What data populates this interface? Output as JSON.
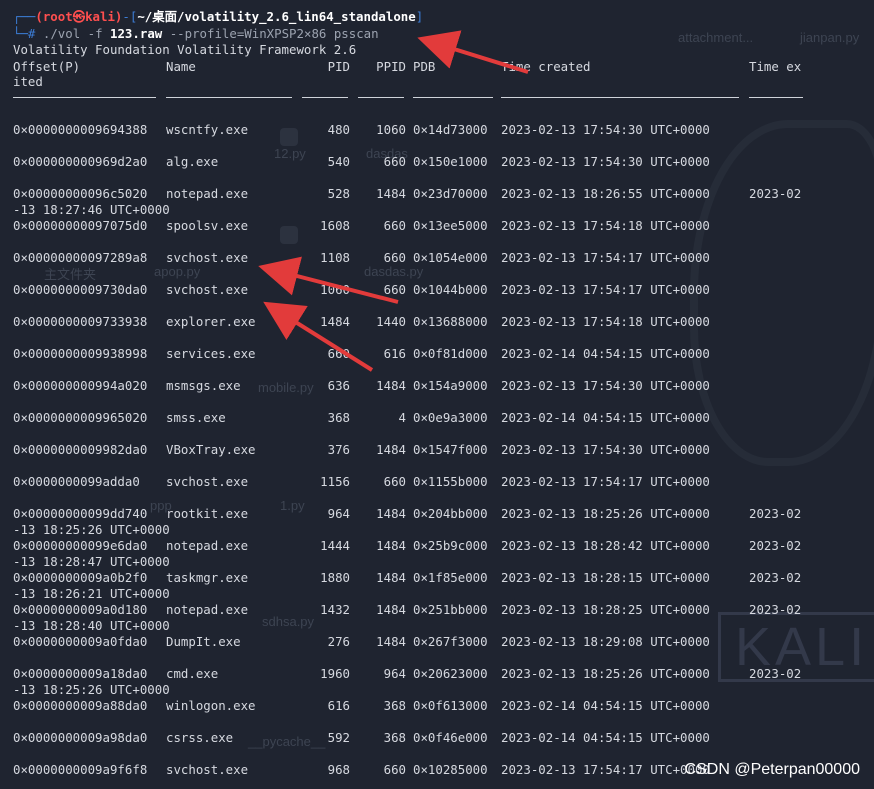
{
  "terminal": {
    "prompt": {
      "user": "(root㉿kali)",
      "dash": "┌──",
      "path": "~/桌面/volatility_2.6_lin64_standalone",
      "hash": "└─#"
    },
    "command": {
      "bin": "./vol -f",
      "file": "123.raw",
      "args": "--profile=WinXPSP2×86 psscan"
    },
    "banner": "Volatility Foundation Volatility Framework 2.6",
    "headers": {
      "offset": "Offset(P)",
      "name": "Name",
      "pid": "PID",
      "ppid": "PPID",
      "pdb": "PDB",
      "created": "Time created",
      "exited": "Time ex",
      "exited_wrap": "ited"
    },
    "rows": [
      {
        "offset": "0×0000000009694388",
        "name": "wscntfy.exe",
        "pid": "480",
        "ppid": "1060",
        "pdb": "0×14d73000",
        "created": "2023-02-13 17:54:30 UTC+0000",
        "exited": "",
        "exited_wrap": ""
      },
      {
        "offset": "0×000000000969d2a0",
        "name": "alg.exe",
        "pid": "540",
        "ppid": "660",
        "pdb": "0×150e1000",
        "created": "2023-02-13 17:54:30 UTC+0000",
        "exited": "",
        "exited_wrap": ""
      },
      {
        "offset": "0×00000000096c5020",
        "name": "notepad.exe",
        "pid": "528",
        "ppid": "1484",
        "pdb": "0×23d70000",
        "created": "2023-02-13 18:26:55 UTC+0000",
        "exited": "2023-02",
        "exited_wrap": "-13 18:27:46 UTC+0000"
      },
      {
        "offset": "0×00000000097075d0",
        "name": "spoolsv.exe",
        "pid": "1608",
        "ppid": "660",
        "pdb": "0×13ee5000",
        "created": "2023-02-13 17:54:18 UTC+0000",
        "exited": "",
        "exited_wrap": ""
      },
      {
        "offset": "0×00000000097289a8",
        "name": "svchost.exe",
        "pid": "1108",
        "ppid": "660",
        "pdb": "0×1054e000",
        "created": "2023-02-13 17:54:17 UTC+0000",
        "exited": "",
        "exited_wrap": ""
      },
      {
        "offset": "0×0000000009730da0",
        "name": "svchost.exe",
        "pid": "1060",
        "ppid": "660",
        "pdb": "0×1044b000",
        "created": "2023-02-13 17:54:17 UTC+0000",
        "exited": "",
        "exited_wrap": ""
      },
      {
        "offset": "0×0000000009733938",
        "name": "explorer.exe",
        "pid": "1484",
        "ppid": "1440",
        "pdb": "0×13688000",
        "created": "2023-02-13 17:54:18 UTC+0000",
        "exited": "",
        "exited_wrap": ""
      },
      {
        "offset": "0×0000000009938998",
        "name": "services.exe",
        "pid": "660",
        "ppid": "616",
        "pdb": "0×0f81d000",
        "created": "2023-02-14 04:54:15 UTC+0000",
        "exited": "",
        "exited_wrap": ""
      },
      {
        "offset": "0×000000000994a020",
        "name": "msmsgs.exe",
        "pid": "636",
        "ppid": "1484",
        "pdb": "0×154a9000",
        "created": "2023-02-13 17:54:30 UTC+0000",
        "exited": "",
        "exited_wrap": ""
      },
      {
        "offset": "0×0000000009965020",
        "name": "smss.exe",
        "pid": "368",
        "ppid": "4",
        "pdb": "0×0e9a3000",
        "created": "2023-02-14 04:54:15 UTC+0000",
        "exited": "",
        "exited_wrap": ""
      },
      {
        "offset": "0×0000000009982da0",
        "name": "VBoxTray.exe",
        "pid": "376",
        "ppid": "1484",
        "pdb": "0×1547f000",
        "created": "2023-02-13 17:54:30 UTC+0000",
        "exited": "",
        "exited_wrap": ""
      },
      {
        "offset": "0×0000000099adda0",
        "name": "svchost.exe",
        "pid": "1156",
        "ppid": "660",
        "pdb": "0×1155b000",
        "created": "2023-02-13 17:54:17 UTC+0000",
        "exited": "",
        "exited_wrap": ""
      },
      {
        "offset": "0×00000000099dd740",
        "name": "rootkit.exe",
        "pid": "964",
        "ppid": "1484",
        "pdb": "0×204bb000",
        "created": "2023-02-13 18:25:26 UTC+0000",
        "exited": "2023-02",
        "exited_wrap": "-13 18:25:26 UTC+0000"
      },
      {
        "offset": "0×00000000099e6da0",
        "name": "notepad.exe",
        "pid": "1444",
        "ppid": "1484",
        "pdb": "0×25b9c000",
        "created": "2023-02-13 18:28:42 UTC+0000",
        "exited": "2023-02",
        "exited_wrap": "-13 18:28:47 UTC+0000"
      },
      {
        "offset": "0×0000000009a0b2f0",
        "name": "taskmgr.exe",
        "pid": "1880",
        "ppid": "1484",
        "pdb": "0×1f85e000",
        "created": "2023-02-13 18:28:15 UTC+0000",
        "exited": "2023-02",
        "exited_wrap": "-13 18:26:21 UTC+0000"
      },
      {
        "offset": "0×0000000009a0d180",
        "name": "notepad.exe",
        "pid": "1432",
        "ppid": "1484",
        "pdb": "0×251bb000",
        "created": "2023-02-13 18:28:25 UTC+0000",
        "exited": "2023-02",
        "exited_wrap": "-13 18:28:40 UTC+0000"
      },
      {
        "offset": "0×0000000009a0fda0",
        "name": "DumpIt.exe",
        "pid": "276",
        "ppid": "1484",
        "pdb": "0×267f3000",
        "created": "2023-02-13 18:29:08 UTC+0000",
        "exited": "",
        "exited_wrap": ""
      },
      {
        "offset": "0×0000000009a18da0",
        "name": "cmd.exe",
        "pid": "1960",
        "ppid": "964",
        "pdb": "0×20623000",
        "created": "2023-02-13 18:25:26 UTC+0000",
        "exited": "2023-02",
        "exited_wrap": "-13 18:25:26 UTC+0000"
      },
      {
        "offset": "0×0000000009a88da0",
        "name": "winlogon.exe",
        "pid": "616",
        "ppid": "368",
        "pdb": "0×0f613000",
        "created": "2023-02-14 04:54:15 UTC+0000",
        "exited": "",
        "exited_wrap": ""
      },
      {
        "offset": "0×0000000009a98da0",
        "name": "csrss.exe",
        "pid": "592",
        "ppid": "368",
        "pdb": "0×0f46e000",
        "created": "2023-02-14 04:54:15 UTC+0000",
        "exited": "",
        "exited_wrap": ""
      },
      {
        "offset": "0×0000000009a9f6f8",
        "name": "svchost.exe",
        "pid": "968",
        "ppid": "660",
        "pdb": "0×10285000",
        "created": "2023-02-13 17:54:17 UTC+0000",
        "exited": "",
        "exited_wrap": ""
      }
    ]
  },
  "desktop_labels": [
    "attachment...",
    "jianpan.py",
    "12.py",
    "dasdas",
    "主文件夹",
    "apop.py",
    "dasdas.py",
    "mobile.py",
    "1.py",
    "ppp",
    "sdhsa.py",
    "__pycache__"
  ],
  "logo_text": "KALI",
  "csdn_watermark": "CSDN @Peterpan00000",
  "colors": {
    "background": "#1f2430",
    "text": "#d6d9e0",
    "prompt": "#ff4f4f",
    "bracket": "#3c7dd6",
    "annotation": "#e23b3b"
  }
}
